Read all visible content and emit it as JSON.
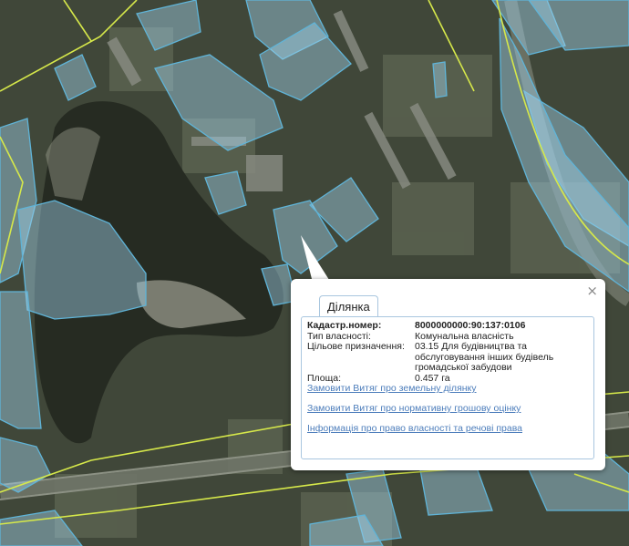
{
  "popup": {
    "tab_label": "Ділянка",
    "close_symbol": "×",
    "fields": [
      {
        "label": "Кадастр.номер:",
        "value": "8000000000:90:137:0106",
        "bold": true
      },
      {
        "label": "Тип власності:",
        "value": "Комунальна власність",
        "bold": false
      },
      {
        "label": "Цільове призначення:",
        "value": "03.15 Для будівництва та обслуговування інших будівель громадської забудови",
        "bold": false
      },
      {
        "label": "Площа:",
        "value": "0.457 га",
        "bold": false
      }
    ],
    "links": [
      "Замовити Витяг про земельну ділянку",
      "Замовити Витяг про нормативну грошову оцінку",
      "Інформація про право власності та речові права"
    ]
  },
  "colors": {
    "parcel_fill": "#9fd0e8",
    "parcel_stroke": "#5fb4d8",
    "boundary_line": "#d6e84a",
    "link": "#4c7dbb",
    "tab_border": "#a9c6df"
  }
}
